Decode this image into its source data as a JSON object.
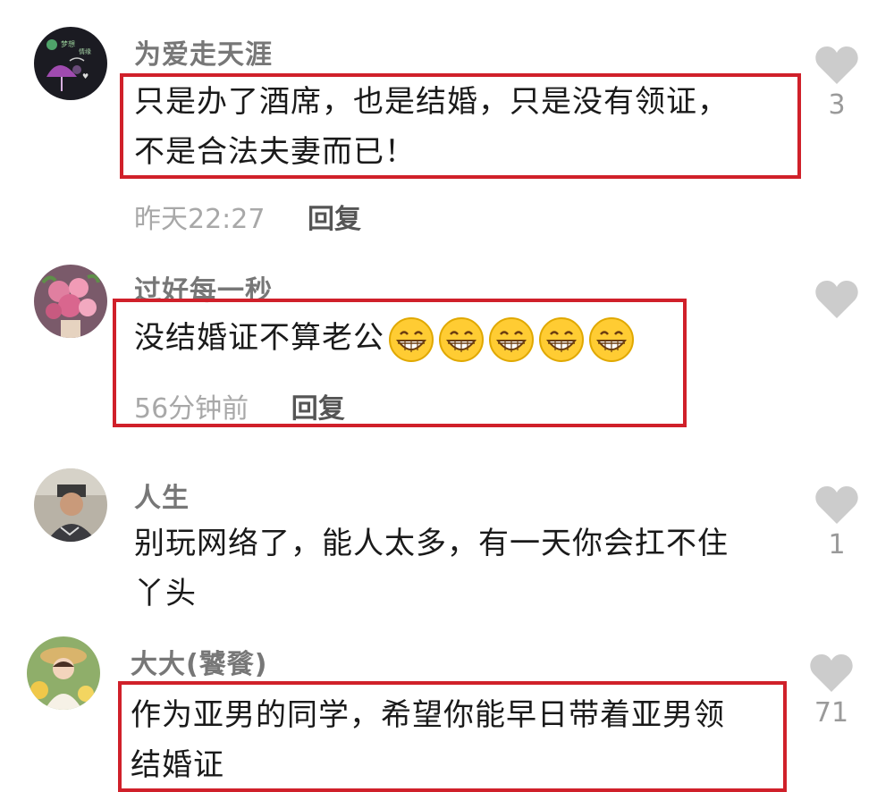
{
  "comments": [
    {
      "username": "为爱走天涯",
      "lines": [
        "只是办了酒席，也是结婚，只是没有领证，",
        "不是合法夫妻而已！"
      ],
      "time": "昨天22:27",
      "reply": "回复",
      "likes": "3"
    },
    {
      "username": "过好每一秒",
      "lines": [
        "没结婚证不算老公"
      ],
      "emoji_count": 5,
      "emoji": "grinning-face-icon",
      "time": "56分钟前",
      "reply": "回复",
      "likes": ""
    },
    {
      "username": "人生",
      "lines": [
        "别玩网络了，能人太多，有一天你会扛不住",
        "丫头"
      ],
      "likes": "1"
    },
    {
      "username": "大大(饕餮)",
      "lines": [
        "作为亚男的同学，希望你能早日带着亚男领",
        "结婚证"
      ],
      "likes": "71"
    }
  ],
  "colors": {
    "highlight_box": "#d0202a",
    "like_icon": "#cccccc"
  }
}
